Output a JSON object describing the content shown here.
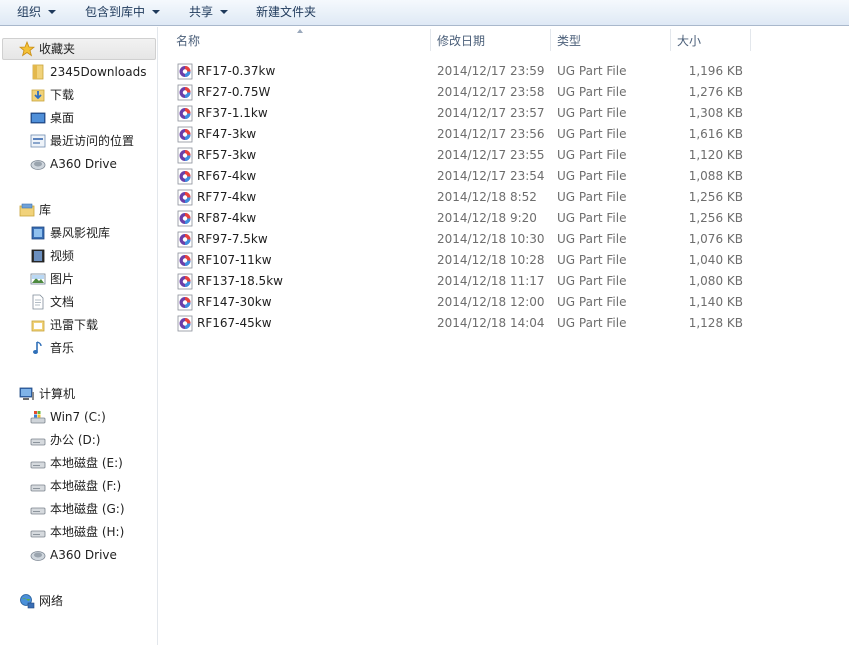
{
  "toolbar": {
    "organize": "组织",
    "include_in_library": "包含到库中",
    "share": "共享",
    "new_folder": "新建文件夹"
  },
  "nav": {
    "favorites": {
      "label": "收藏夹",
      "items": [
        {
          "label": "2345Downloads",
          "icon": "folder-icon"
        },
        {
          "label": "下载",
          "icon": "downloads-icon"
        },
        {
          "label": "桌面",
          "icon": "desktop-icon"
        },
        {
          "label": "最近访问的位置",
          "icon": "recent-places-icon"
        },
        {
          "label": "A360 Drive",
          "icon": "a360-drive-icon"
        }
      ]
    },
    "libraries": {
      "label": "库",
      "items": [
        {
          "label": "暴风影视库",
          "icon": "video-library-icon"
        },
        {
          "label": "视频",
          "icon": "video-icon"
        },
        {
          "label": "图片",
          "icon": "pictures-icon"
        },
        {
          "label": "文档",
          "icon": "documents-icon"
        },
        {
          "label": "迅雷下载",
          "icon": "thunder-download-icon"
        },
        {
          "label": "音乐",
          "icon": "music-icon"
        }
      ]
    },
    "computer": {
      "label": "计算机",
      "items": [
        {
          "label": "Win7 (C:)",
          "icon": "system-drive-icon"
        },
        {
          "label": "办公 (D:)",
          "icon": "drive-icon"
        },
        {
          "label": "本地磁盘 (E:)",
          "icon": "drive-icon"
        },
        {
          "label": "本地磁盘 (F:)",
          "icon": "drive-icon"
        },
        {
          "label": "本地磁盘 (G:)",
          "icon": "drive-icon"
        },
        {
          "label": "本地磁盘 (H:)",
          "icon": "drive-icon"
        },
        {
          "label": "A360 Drive",
          "icon": "a360-drive-icon"
        }
      ]
    },
    "network": {
      "label": "网络",
      "icon": "network-icon"
    }
  },
  "columns": {
    "name": "名称",
    "date": "修改日期",
    "type": "类型",
    "size": "大小"
  },
  "files": [
    {
      "name": "RF17-0.37kw",
      "date": "2014/12/17 23:59",
      "type": "UG Part File",
      "size": "1,196 KB"
    },
    {
      "name": "RF27-0.75W",
      "date": "2014/12/17 23:58",
      "type": "UG Part File",
      "size": "1,276 KB"
    },
    {
      "name": "RF37-1.1kw",
      "date": "2014/12/17 23:57",
      "type": "UG Part File",
      "size": "1,308 KB"
    },
    {
      "name": "RF47-3kw",
      "date": "2014/12/17 23:56",
      "type": "UG Part File",
      "size": "1,616 KB"
    },
    {
      "name": "RF57-3kw",
      "date": "2014/12/17 23:55",
      "type": "UG Part File",
      "size": "1,120 KB"
    },
    {
      "name": "RF67-4kw",
      "date": "2014/12/17 23:54",
      "type": "UG Part File",
      "size": "1,088 KB"
    },
    {
      "name": "RF77-4kw",
      "date": "2014/12/18 8:52",
      "type": "UG Part File",
      "size": "1,256 KB"
    },
    {
      "name": "RF87-4kw",
      "date": "2014/12/18 9:20",
      "type": "UG Part File",
      "size": "1,256 KB"
    },
    {
      "name": "RF97-7.5kw",
      "date": "2014/12/18 10:30",
      "type": "UG Part File",
      "size": "1,076 KB"
    },
    {
      "name": "RF107-11kw",
      "date": "2014/12/18 10:28",
      "type": "UG Part File",
      "size": "1,040 KB"
    },
    {
      "name": "RF137-18.5kw",
      "date": "2014/12/18 11:17",
      "type": "UG Part File",
      "size": "1,080 KB"
    },
    {
      "name": "RF147-30kw",
      "date": "2014/12/18 12:00",
      "type": "UG Part File",
      "size": "1,140 KB"
    },
    {
      "name": "RF167-45kw",
      "date": "2014/12/18 14:04",
      "type": "UG Part File",
      "size": "1,128 KB"
    }
  ],
  "file_icon": "ug-part-file-icon"
}
